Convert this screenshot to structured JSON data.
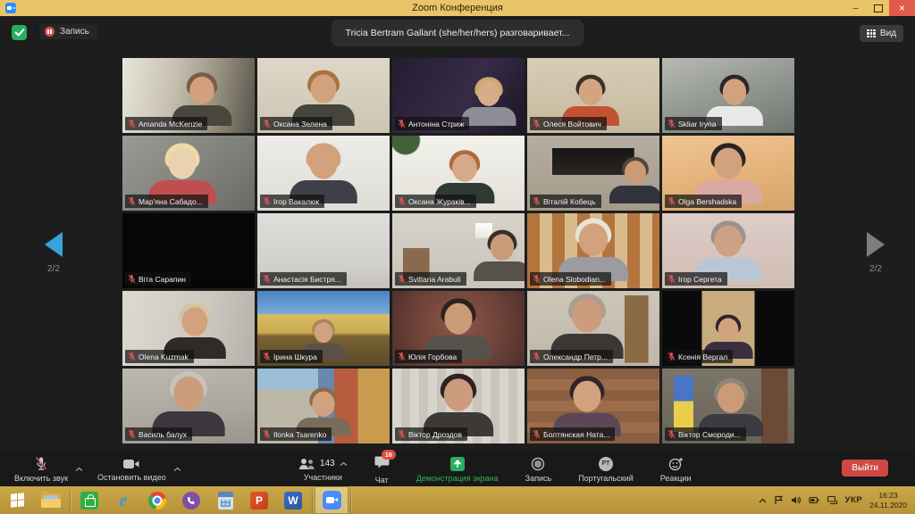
{
  "window": {
    "title": "Zoom Конференция",
    "controls": {
      "minimize": "–",
      "close": "×"
    }
  },
  "topbar": {
    "recording_label": "Запись",
    "speaking_notice": "Tricia Bertram Gallant (she/her/hers) разговаривает...",
    "view_label": "Вид"
  },
  "gallery": {
    "page_indicator": "2/2",
    "participants": [
      {
        "name": "Amanda McKenzie",
        "bg": "linear-gradient(100deg,#e9e5da 0%,#c6c0b2 38%,#98927f 68%,#57534a 100%)",
        "hair": "#7a5c42",
        "skin": "#d2a07c",
        "shirt": "#4a463e",
        "x": 60,
        "s": 1.15
      },
      {
        "name": "Оксана Зелена",
        "bg": "linear-gradient(180deg,#ded7c7 0%,#cdc5b2 100%)",
        "hair": "#a9743c",
        "skin": "#d2a27e",
        "shirt": "#45453c",
        "x": 50,
        "s": 1.2
      },
      {
        "name": "Антоніна Стриж",
        "bg": "linear-gradient(120deg,#251c31 0%,#372b46 55%,#1d1627 100%)",
        "hair": "#c9a96e",
        "skin": "#d6ad88",
        "shirt": "#8d8d95",
        "x": 73,
        "s": 1.05
      },
      {
        "name": "Олеся Войтович",
        "bg": "linear-gradient(180deg,#d7ccb5 0%,#c5b89e 100%)",
        "hair": "#3c302a",
        "skin": "#d2a581",
        "shirt": "#c25332",
        "x": 48,
        "s": 1.1
      },
      {
        "name": "Skliar Iryna",
        "bg": "linear-gradient(160deg,#b7b9b3 0%,#8f948f 55%,#6f7570 100%)",
        "hair": "#2e2626",
        "skin": "#d2a27e",
        "shirt": "#e9e9e9",
        "x": 55,
        "s": 1.1
      },
      {
        "name": "Мар'яна Сабадо...",
        "bg": "linear-gradient(140deg,#9b9b95 0%,#7f7f79 60%,#6a6a64 100%)",
        "hair": "#ecdba6",
        "skin": "#ead1b0",
        "shirt": "#c04e4e",
        "x": 45,
        "s": 1.3
      },
      {
        "name": "Ігор Вакалюк",
        "bg": "linear-gradient(180deg,#edece8 0%,#dedcd6 100%)",
        "hair": "#d2a27e",
        "skin": "#d2a27e",
        "shirt": "#3f3f47",
        "x": 50,
        "s": 1.3
      },
      {
        "name": "Оксана Жураків...",
        "bg": "radial-gradient(circle at 10% 6%,#42603a 0 10%,rgba(0,0,0,0) 11%),linear-gradient(180deg,#f1f0ea 0%,#e3e1d9 100%)",
        "hair": "#b06a3c",
        "skin": "#d6aa88",
        "shirt": "#303a34",
        "x": 55,
        "s": 1.15
      },
      {
        "name": "Віталій Кобець",
        "bg": "linear-gradient(#161616,#2b2525) 50% 26%/62% 36% no-repeat,linear-gradient(180deg,#b5ad9f 0%,#a49a8a 100%)",
        "hair": "#55443a",
        "skin": "#cb9b78",
        "shirt": "#33333b",
        "x": 82,
        "s": 1.0
      },
      {
        "name": "Olga Bershadska",
        "bg": "linear-gradient(170deg,#efc493 0%,#e3b178 60%,#d6a369 100%)",
        "hair": "#2c2424",
        "skin": "#d2a27e",
        "shirt": "#d9a9a3",
        "x": 50,
        "s": 1.3
      },
      {
        "name": "Віта Сарапин",
        "bg": "#060606",
        "person": false
      },
      {
        "name": "Анастасія Бистря...",
        "bg": "linear-gradient(180deg,#dddddb 0%,#d0d0cc 70%,#c4c1b9 100%)",
        "person": false
      },
      {
        "name": "Svitlana Arabuli",
        "bg": "linear-gradient(#8a6a4e,#8a6a4e) 10% 82%/20% 44% no-repeat,linear-gradient(#fdfdfb,#e8e8e2) 72% 16%/13% 20% no-repeat,linear-gradient(180deg,#d7d3c9 0%,#c7c3b7 100%)",
        "hair": "#3a2e2a",
        "skin": "#cb9b78",
        "shirt": "#56514b",
        "x": 83,
        "s": 1.1
      },
      {
        "name": "Olena Slobodian...",
        "bg": "repeating-linear-gradient(90deg,#b3753d 0 14px,#d9ba8d 14px 28px)",
        "hair": "#e7e3d9",
        "skin": "#d2a27e",
        "shirt": "#9b9ba1",
        "x": 50,
        "s": 1.35
      },
      {
        "name": "Ігор Сергета",
        "bg": "linear-gradient(180deg,#ddcdc7 0%,#d0bdb5 100%)",
        "hair": "#9b9389",
        "skin": "#cba285",
        "shirt": "#b9c7d5",
        "x": 50,
        "s": 1.3
      },
      {
        "name": "Olena Kuzmak",
        "bg": "linear-gradient(100deg,#ddd9d1 0%,#cdc9c1 60%,#b5b1a9 100%)",
        "hair": "#d3c4a3",
        "skin": "#d2a27e",
        "shirt": "#2f2b29",
        "x": 55,
        "s": 1.2
      },
      {
        "name": "Ірина Шкура",
        "bg": "linear-gradient(180deg,#4a84c4 0%,#79a9d9 30%,#d9bd61 32%,#c9a94f 56%,#7b6335 60%,#5b4b29 100%)",
        "hair": "#a9855b",
        "skin": "#d2a27e",
        "shirt": "#5b5149",
        "x": 50,
        "s": 0.85
      },
      {
        "name": "Юлія Горбова",
        "bg": "radial-gradient(circle at 50% 45%,#8b574b 0%,#6f4339 55%,#4b2f29 100%)",
        "hair": "#2c2220",
        "skin": "#cb9b78",
        "shirt": "#56514b",
        "x": 50,
        "s": 1.3
      },
      {
        "name": "Олександр Петр...",
        "bg": "linear-gradient(#8b6b45,#8b6b45) 90% 55%/18% 90% no-repeat,linear-gradient(180deg,#cdc5b7 0%,#bfb7a9 100%)",
        "hair": "#a99f93",
        "skin": "#cc9c7c",
        "shirt": "#3b3735",
        "x": 45,
        "s": 1.4
      },
      {
        "name": "Ксенія Вергал",
        "bg": "linear-gradient(90deg,#0a0a0a 0 30%,#c9ac7d 30% 70%,#0a0a0a 70% 100%)",
        "hair": "#2e2430",
        "skin": "#d2a27e",
        "shirt": "#3b2f3f",
        "x": 50,
        "s": 0.95
      },
      {
        "name": "Василь балух",
        "bg": "linear-gradient(170deg,#bdb9b1 0%,#aba79f 60%,#99958d 100%)",
        "hair": "#c7c3bb",
        "skin": "#cc9c7c",
        "shirt": "#3b373d",
        "x": 50,
        "s": 1.4
      },
      {
        "name": "Ilonka Tsarenko",
        "bg": "linear-gradient(180deg,rgba(152,192,222,0.9) 0 28%,rgba(0,0,0,0) 28%) 0 0/46% 100% no-repeat,linear-gradient(90deg,#bdb7a7 0 46%,#6b87b1 46% 58%,#b95b3d 58% 76%,#c99b4f 76% 100%)",
        "hair": "#8b6b49",
        "skin": "#d2a27e",
        "shirt": "#7b6b5b",
        "x": 50,
        "s": 1.05
      },
      {
        "name": "Віктор Дроздов",
        "bg": "repeating-linear-gradient(90deg,#d9d5cd 0 10px,#c9c5bb 10px 20px)",
        "hair": "#2a2424",
        "skin": "#cc9c7c",
        "shirt": "#3d3935",
        "x": 50,
        "s": 1.35
      },
      {
        "name": "Болтянская Ната...",
        "bg": "repeating-linear-gradient(0deg,#8b5f41 0 12px,#9d6d4b 12px 24px)",
        "hair": "#302428",
        "skin": "#d2a27e",
        "shirt": "#5b4757",
        "x": 45,
        "s": 1.3
      },
      {
        "name": "Віктор Смороди...",
        "bg": "linear-gradient(180deg,#4a74c4 0 45%,#e9cd4f 45% 100%) 10% 40%/15% 75% no-repeat,linear-gradient(#6b4b35,#6b4b35) 94% 50%/20% 100% no-repeat,linear-gradient(180deg,#7b7569 0%,#6b6559 100%)",
        "hair": "#8f8579",
        "skin": "#cb9b78",
        "shirt": "#3b3b41",
        "x": 52,
        "s": 1.25
      }
    ]
  },
  "toolbar": {
    "mute_label": "Включить звук",
    "stop_video_label": "Остановить видео",
    "participants_label": "Участники",
    "participants_count": "143",
    "chat_label": "Чат",
    "chat_badge": "16",
    "share_label": "Демонстрация экрана",
    "record_label": "Запись",
    "interpretation_label": "Португальский",
    "interpretation_badge": "PT",
    "reactions_label": "Реакции",
    "leave_label": "Выйти"
  },
  "taskbar": {
    "language": "УКР",
    "time": "16:23",
    "date": "24.11.2020",
    "apps": [
      {
        "name": "start"
      },
      {
        "name": "file-explorer"
      },
      {
        "name": "store"
      },
      {
        "name": "internet-explorer",
        "glyph": "e"
      },
      {
        "name": "chrome"
      },
      {
        "name": "viber"
      },
      {
        "name": "calculator"
      },
      {
        "name": "powerpoint",
        "glyph": "P"
      },
      {
        "name": "word",
        "glyph": "W"
      },
      {
        "name": "zoom",
        "active": true
      }
    ]
  },
  "colors": {
    "titlebar_gold": "#e9c468",
    "taskbar_gold": "#bf9c3e",
    "close_red": "#e25a4c",
    "record_red": "#e04b4b",
    "mic_muted_red": "#e05252",
    "leave_red": "#cf4944",
    "share_green": "#27ae60",
    "share_text_green": "#2bb45a",
    "shield_green": "#27ae60",
    "nav_active_blue": "#35a3dc",
    "nav_inactive_gray": "#7d7d7d",
    "badge_red": "#e04b43"
  }
}
